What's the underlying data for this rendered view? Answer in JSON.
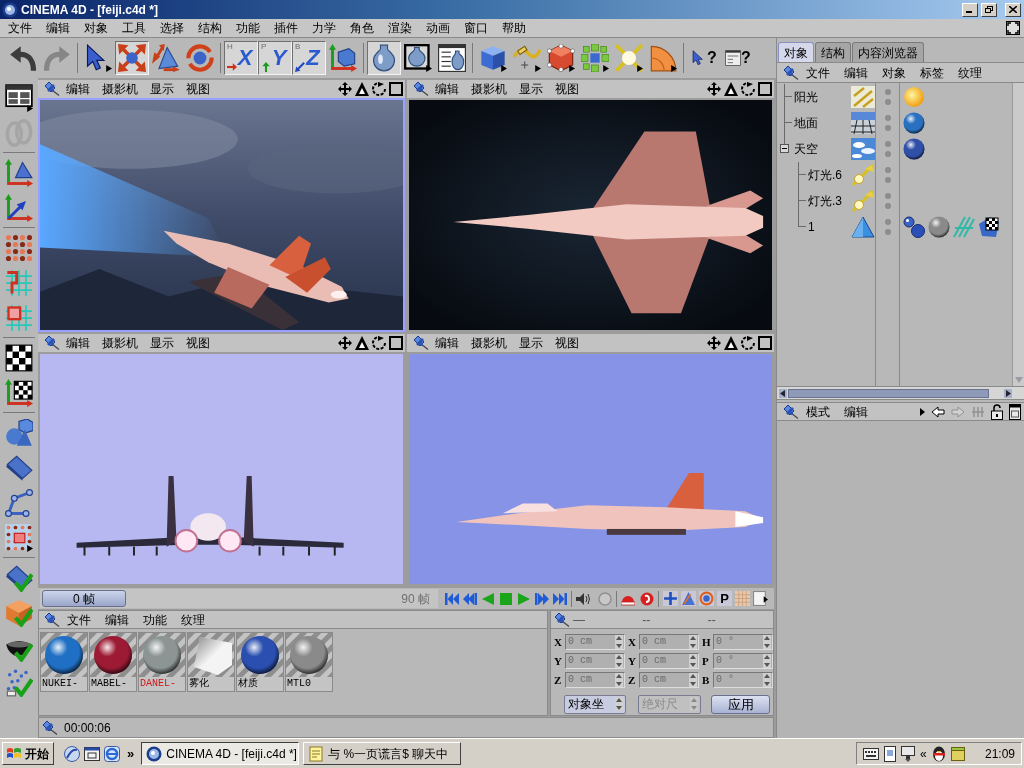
{
  "window": {
    "title": "CINEMA 4D - [feiji.c4d *]"
  },
  "menu_bar": {
    "items": [
      "文件",
      "编辑",
      "对象",
      "工具",
      "选择",
      "结构",
      "功能",
      "插件",
      "力学",
      "角色",
      "渲染",
      "动画",
      "窗口",
      "帮助"
    ]
  },
  "toolbar": {
    "groups": [
      [
        {
          "kind": "undo",
          "active": false,
          "disabled": false
        },
        {
          "kind": "redo",
          "active": false,
          "disabled": true
        }
      ],
      [
        {
          "kind": "pointer",
          "active": false,
          "disabled": false
        },
        {
          "kind": "move",
          "active": true,
          "disabled": false
        },
        {
          "kind": "scale",
          "active": false,
          "disabled": false
        },
        {
          "kind": "rotate",
          "active": false,
          "disabled": false
        }
      ],
      [
        {
          "kind": "axis-x",
          "label": "X",
          "corner": "H",
          "active": true,
          "disabled": false
        },
        {
          "kind": "axis-y",
          "label": "Y",
          "corner": "P",
          "active": true,
          "disabled": false
        },
        {
          "kind": "axis-z",
          "label": "Z",
          "corner": "B",
          "active": true,
          "disabled": false
        },
        {
          "kind": "world",
          "active": false,
          "disabled": false
        }
      ],
      [
        {
          "kind": "render-view",
          "active": true,
          "disabled": false
        },
        {
          "kind": "render-picture",
          "active": false,
          "disabled": false
        },
        {
          "kind": "render-settings",
          "active": false,
          "disabled": false
        }
      ],
      [
        {
          "kind": "cube",
          "active": false,
          "disabled": false
        },
        {
          "kind": "spline",
          "active": false,
          "disabled": false
        },
        {
          "kind": "nurbs",
          "active": false,
          "disabled": false
        },
        {
          "kind": "array",
          "active": false,
          "disabled": false
        },
        {
          "kind": "deformer",
          "active": false,
          "disabled": false
        },
        {
          "kind": "scene",
          "active": false,
          "disabled": false
        }
      ],
      [
        {
          "kind": "help-cursor",
          "label": "?",
          "active": false,
          "disabled": false
        },
        {
          "kind": "help-window",
          "label": "?",
          "active": false,
          "disabled": false
        }
      ]
    ]
  },
  "side_toolbar": {
    "groups": [
      [
        {
          "kind": "layout",
          "disabled": false
        },
        {
          "kind": "loops",
          "disabled": true
        }
      ],
      [
        {
          "kind": "axis-pyramid",
          "disabled": false
        },
        {
          "kind": "axis",
          "disabled": false
        }
      ],
      [
        {
          "kind": "points",
          "disabled": false
        },
        {
          "kind": "edges",
          "disabled": false
        },
        {
          "kind": "polygons",
          "disabled": false
        }
      ],
      [
        {
          "kind": "checker",
          "disabled": false
        },
        {
          "kind": "axis-checker",
          "disabled": false
        }
      ],
      [
        {
          "kind": "shapes",
          "disabled": false
        },
        {
          "kind": "plank",
          "disabled": false
        },
        {
          "kind": "bones",
          "disabled": false
        },
        {
          "kind": "select",
          "disabled": false
        }
      ],
      [
        {
          "kind": "plank-check",
          "disabled": false
        },
        {
          "kind": "box-check",
          "disabled": false
        },
        {
          "kind": "bowl-check",
          "disabled": false
        },
        {
          "kind": "particles-check",
          "disabled": false
        }
      ]
    ]
  },
  "viewports": [
    {
      "kind": "perspective",
      "selected": true,
      "menus": [
        "编辑",
        "摄影机",
        "显示",
        "视图"
      ]
    },
    {
      "kind": "top",
      "selected": false,
      "menus": [
        "编辑",
        "摄影机",
        "显示",
        "视图"
      ]
    },
    {
      "kind": "front",
      "selected": false,
      "menus": [
        "编辑",
        "摄影机",
        "显示",
        "视图"
      ]
    },
    {
      "kind": "side",
      "selected": false,
      "menus": [
        "编辑",
        "摄影机",
        "显示",
        "视图"
      ]
    }
  ],
  "timeline": {
    "current_frame": "0 帧",
    "level": 0,
    "end_frame": "90 帧",
    "key_label": "P"
  },
  "material_manager": {
    "menus": [
      "文件",
      "编辑",
      "功能",
      "纹理"
    ],
    "materials": [
      {
        "name": "NUKEI-",
        "kind": "sphere",
        "color": "#1f6fc4",
        "selected": false
      },
      {
        "name": "MABEL-",
        "kind": "sphere",
        "color": "#9c1a34",
        "selected": false
      },
      {
        "name": "DANEL-",
        "kind": "sphere",
        "color": "#8c9494",
        "selected": true
      },
      {
        "name": "雾化",
        "kind": "fog",
        "color": "#f4f4f4",
        "selected": false
      },
      {
        "name": "材质",
        "kind": "sphere",
        "color": "#2a4fb0",
        "selected": false
      },
      {
        "name": "MTL0",
        "kind": "sphere",
        "color": "#8a8a8a",
        "selected": false
      }
    ]
  },
  "coordinates": {
    "headers": [
      "—",
      "--",
      "--"
    ],
    "rows": [
      [
        {
          "axis": "X",
          "value": "0 cm",
          "disabled": true
        },
        {
          "axis": "X",
          "value": "0 cm",
          "disabled": true
        },
        {
          "axis": "H",
          "value": "0 °",
          "disabled": true
        }
      ],
      [
        {
          "axis": "Y",
          "value": "0 cm",
          "disabled": true
        },
        {
          "axis": "Y",
          "value": "0 cm",
          "disabled": true
        },
        {
          "axis": "P",
          "value": "0 °",
          "disabled": true
        }
      ],
      [
        {
          "axis": "Z",
          "value": "0 cm",
          "disabled": true
        },
        {
          "axis": "Z",
          "value": "0 cm",
          "disabled": true
        },
        {
          "axis": "B",
          "value": "0 °",
          "disabled": true
        }
      ]
    ],
    "mode": {
      "value": "对象坐",
      "disabled": false
    },
    "size_mode": {
      "value": "绝对尺",
      "disabled": true
    },
    "apply": "应用"
  },
  "status_bar": {
    "time": "00:00:06"
  },
  "object_manager": {
    "tabs": [
      {
        "label": "对象",
        "selected": true
      },
      {
        "label": "结构",
        "selected": false
      },
      {
        "label": "内容浏览器",
        "selected": false
      }
    ],
    "menus": [
      "文件",
      "编辑",
      "对象",
      "标签",
      "纹理"
    ],
    "objects": [
      {
        "name": "阳光",
        "kind": "sun-light",
        "tags": [
          {
            "kind": "sun"
          }
        ]
      },
      {
        "name": "地面",
        "kind": "floor",
        "tags": [
          {
            "kind": "material",
            "color": "#2a70c0"
          }
        ]
      },
      {
        "name": "天空",
        "kind": "sky",
        "expanded": true,
        "tags": [
          {
            "kind": "material",
            "color": "#3050a8"
          }
        ],
        "children": [
          {
            "name": "灯光.6",
            "kind": "light"
          },
          {
            "name": "灯光.3",
            "kind": "light"
          },
          {
            "name": "1",
            "kind": "polygon",
            "tags": [
              {
                "kind": "molecule"
              },
              {
                "kind": "material",
                "color": "#8a8a8a"
              },
              {
                "kind": "lines"
              },
              {
                "kind": "checker"
              }
            ]
          }
        ]
      }
    ]
  },
  "attribute_manager": {
    "menus": [
      "模式",
      "编辑"
    ],
    "nav": [
      {
        "kind": "back",
        "disabled": false
      },
      {
        "kind": "forward",
        "disabled": true
      },
      {
        "kind": "levels",
        "disabled": true
      }
    ]
  },
  "taskbar": {
    "start": "开始",
    "overflow": "»",
    "tasks": [
      {
        "label": "CINEMA 4D - [feiji.c4d *]",
        "kind": "cinema",
        "selected": true
      },
      {
        "label": "与 %一页谎言$ 聊天中",
        "kind": "chat",
        "selected": false
      }
    ],
    "tray_overflow": "«",
    "clock": "21:09"
  }
}
